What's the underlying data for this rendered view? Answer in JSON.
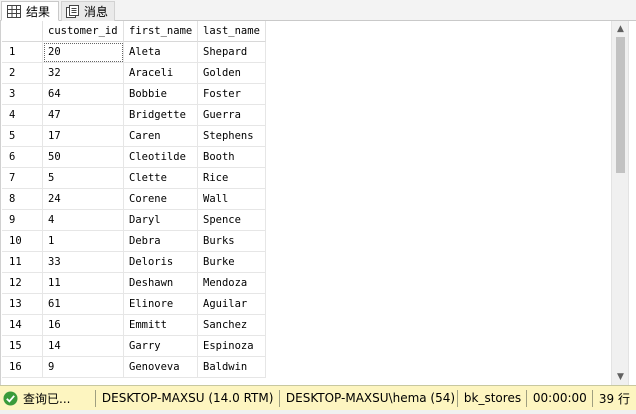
{
  "tabs": [
    {
      "label": "结果",
      "icon": "grid-icon",
      "active": true
    },
    {
      "label": "消息",
      "icon": "messages-icon",
      "active": false
    }
  ],
  "grid": {
    "columns": [
      "customer_id",
      "first_name",
      "last_name"
    ],
    "rows": [
      {
        "num": "1",
        "customer_id": "20",
        "first_name": "Aleta",
        "last_name": "Shepard"
      },
      {
        "num": "2",
        "customer_id": "32",
        "first_name": "Araceli",
        "last_name": "Golden"
      },
      {
        "num": "3",
        "customer_id": "64",
        "first_name": "Bobbie",
        "last_name": "Foster"
      },
      {
        "num": "4",
        "customer_id": "47",
        "first_name": "Bridgette",
        "last_name": "Guerra"
      },
      {
        "num": "5",
        "customer_id": "17",
        "first_name": "Caren",
        "last_name": "Stephens"
      },
      {
        "num": "6",
        "customer_id": "50",
        "first_name": "Cleotilde",
        "last_name": "Booth"
      },
      {
        "num": "7",
        "customer_id": "5",
        "first_name": "Clette",
        "last_name": "Rice"
      },
      {
        "num": "8",
        "customer_id": "24",
        "first_name": "Corene",
        "last_name": "Wall"
      },
      {
        "num": "9",
        "customer_id": "4",
        "first_name": "Daryl",
        "last_name": "Spence"
      },
      {
        "num": "10",
        "customer_id": "1",
        "first_name": "Debra",
        "last_name": "Burks"
      },
      {
        "num": "11",
        "customer_id": "33",
        "first_name": "Deloris",
        "last_name": "Burke"
      },
      {
        "num": "12",
        "customer_id": "11",
        "first_name": "Deshawn",
        "last_name": "Mendoza"
      },
      {
        "num": "13",
        "customer_id": "61",
        "first_name": "Elinore",
        "last_name": "Aguilar"
      },
      {
        "num": "14",
        "customer_id": "16",
        "first_name": "Emmitt",
        "last_name": "Sanchez"
      },
      {
        "num": "15",
        "customer_id": "14",
        "first_name": "Garry",
        "last_name": "Espinoza"
      },
      {
        "num": "16",
        "customer_id": "9",
        "first_name": "Genoveva",
        "last_name": "Baldwin"
      }
    ],
    "selected_cell": {
      "row": 0,
      "column": "customer_id"
    }
  },
  "status": {
    "icon": "success-check-icon",
    "query_status": "查询已...",
    "server": "DESKTOP-MAXSU (14.0 RTM)",
    "login": "DESKTOP-MAXSU\\hema (54)",
    "database": "bk_stores",
    "elapsed": "00:00:00",
    "rows_count": "39 行"
  },
  "colors": {
    "status_bar": "#fdf5c0",
    "success_icon": "#3a9b3a",
    "scroll_thumb": "#c2c2c2"
  },
  "scrollbar": {
    "visible_rows": 16,
    "total_rows": 39,
    "scroll_position": 0
  }
}
